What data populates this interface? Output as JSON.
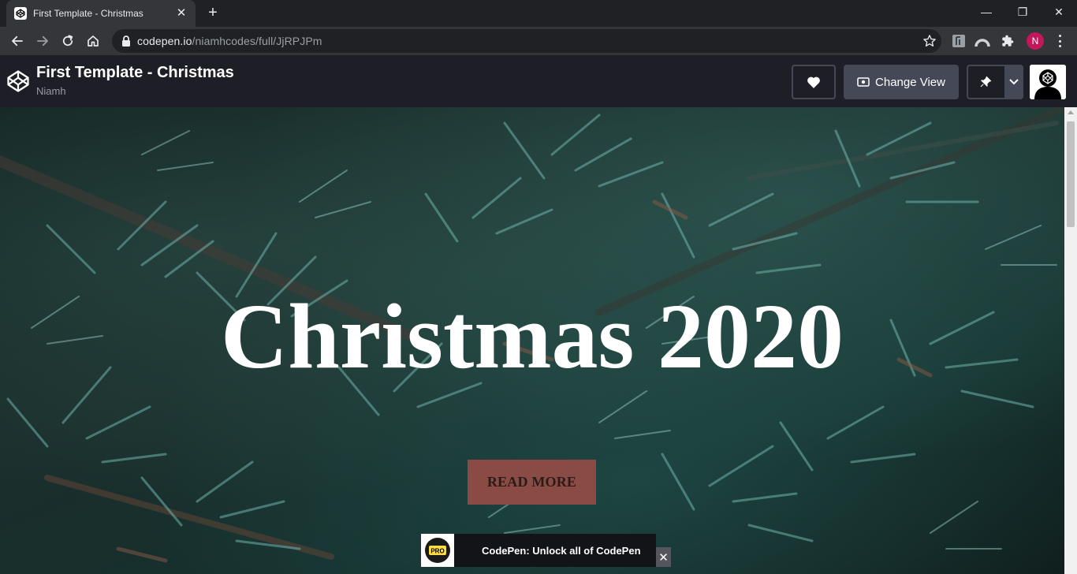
{
  "browser": {
    "tab_title": "First Template - Christmas",
    "tab_close": "✕",
    "new_tab": "+",
    "url_host": "codepen.io",
    "url_path": "/niamhcodes/full/JjRPJPm",
    "profile_initial": "N",
    "window_controls": {
      "minimize": "—",
      "maximize": "❐",
      "close": "✕"
    }
  },
  "codepen": {
    "title": "First Template - Christmas",
    "author": "Niamh",
    "change_view_label": "Change View"
  },
  "page": {
    "hero_title": "Christmas 2020",
    "read_more_label": "READ MORE"
  },
  "promo": {
    "badge": "PRO",
    "text": "CodePen: Unlock all of CodePen",
    "close": "✕"
  },
  "colors": {
    "header_bg": "#1e1f26",
    "button_bg": "#444857",
    "read_more_bg": "#8a4b45",
    "profile_bg": "#c2185b"
  },
  "icons": [
    "codepen-icon",
    "back-arrow-icon",
    "forward-arrow-icon",
    "reload-icon",
    "home-icon",
    "lock-icon",
    "star-icon",
    "extension-icon",
    "puzzle-icon",
    "heart-icon",
    "eye-icon",
    "pin-icon",
    "chevron-down-icon",
    "close-icon"
  ]
}
